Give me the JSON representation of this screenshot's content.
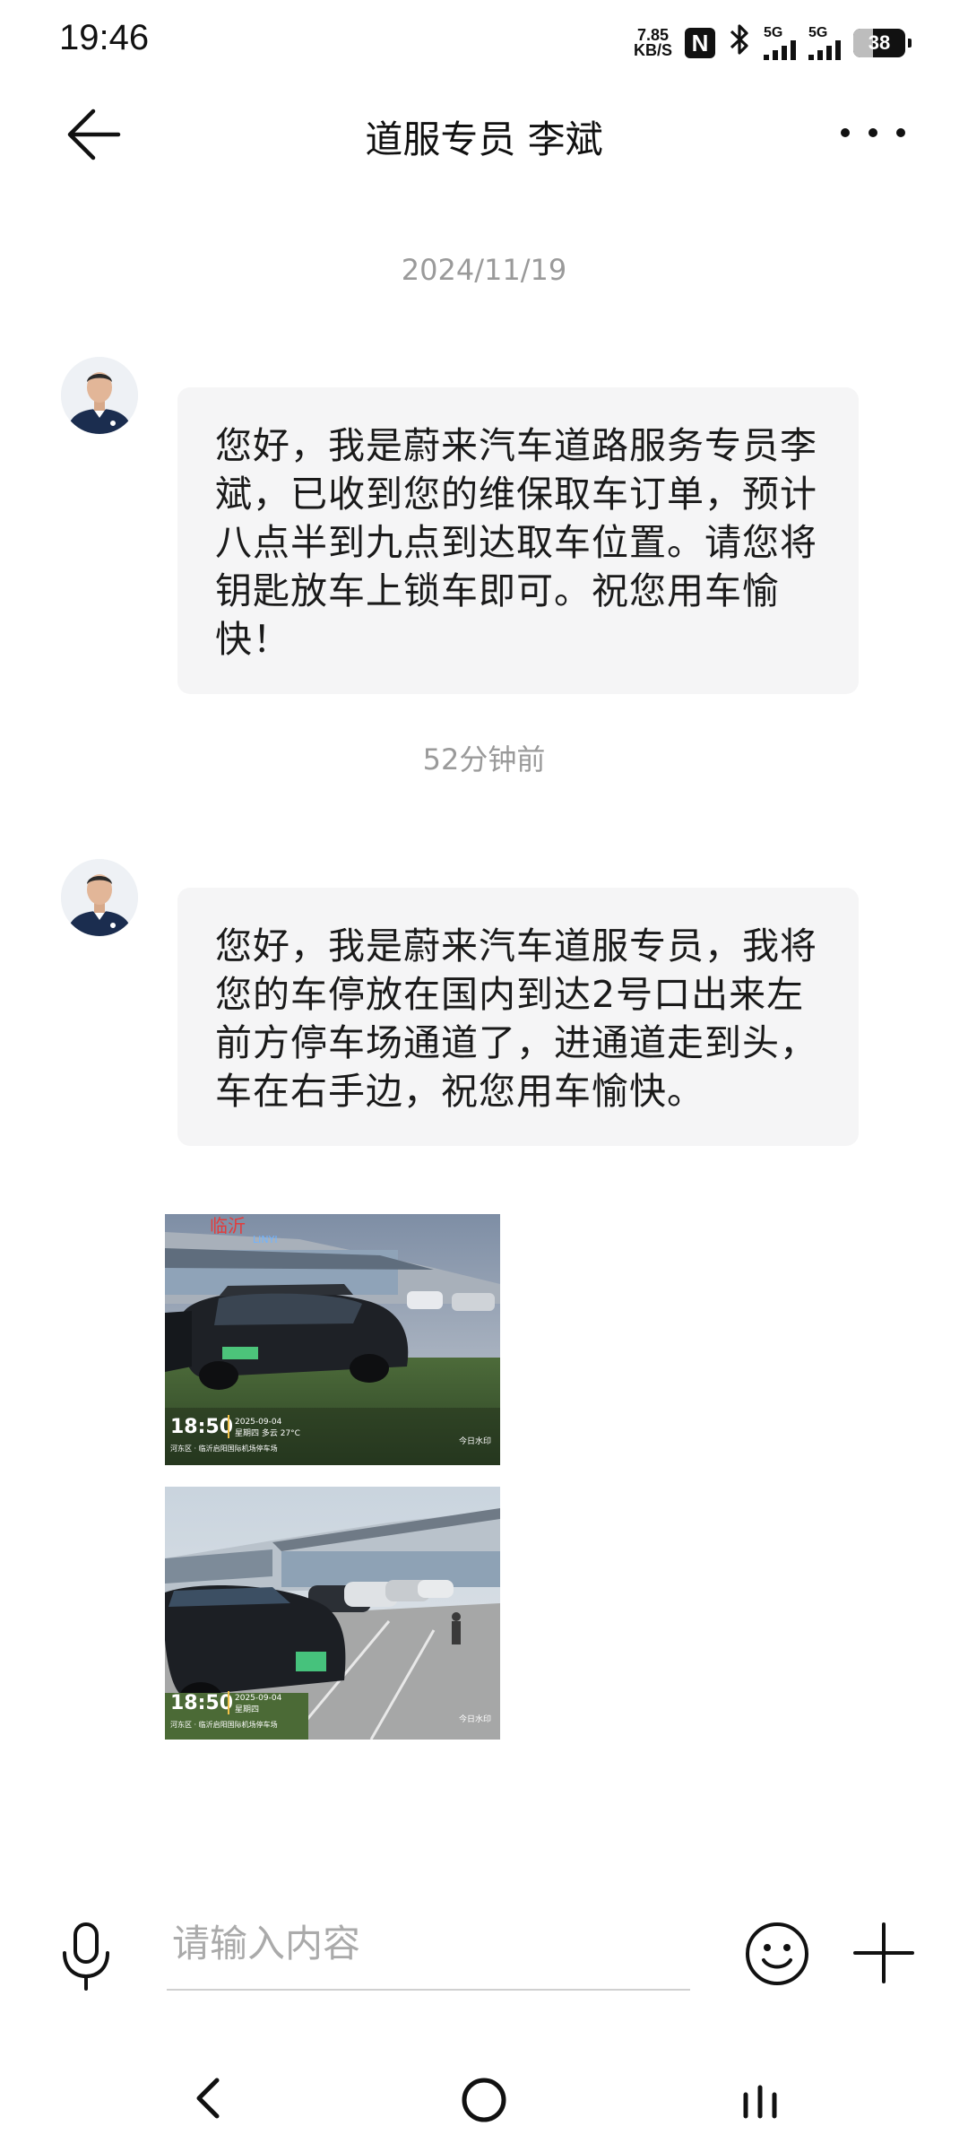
{
  "status_bar": {
    "time": "19:46",
    "net_speed_value": "7.85",
    "net_speed_unit": "KB/S",
    "nfc_label": "N",
    "sim1_label": "5G",
    "sim2_label": "5G",
    "battery_level": "38"
  },
  "header": {
    "title": "道服专员 李斌"
  },
  "messages": [
    {
      "timestamp": "2024/11/19",
      "text": "您好，我是蔚来汽车道路服务专员李斌，已收到您的维保取车订单，预计八点半到九点到达取车位置。请您将钥匙放车上锁车即可。祝您用车愉快！"
    },
    {
      "timestamp": "52分钟前",
      "text": "您好，我是蔚来汽车道服专员，我将您的车停放在国内到达2号口出来左前方停车场通道了，进通道走到头，车在右手边，祝您用车愉快。"
    }
  ],
  "photos": [
    {
      "time": "18:50",
      "date": "2025-09-04",
      "weekday_weather": "星期四  多云 27°C",
      "location": "河东区 · 临沂启阳国际机场停车场",
      "watermark": "今日水印",
      "sign_text": "临沂",
      "sign_latin": "LINYI"
    },
    {
      "time": "18:50",
      "date": "2025-09-04",
      "weekday_weather": "星期四",
      "location": "河东区 · 临沂启阳国际机场停车场",
      "watermark": "今日水印"
    }
  ],
  "input": {
    "placeholder": "请输入内容"
  },
  "colors": {
    "bubble_bg": "#f5f5f6",
    "timestamp": "#9a9a9a",
    "avatar_shirt": "#1b2d4f"
  }
}
